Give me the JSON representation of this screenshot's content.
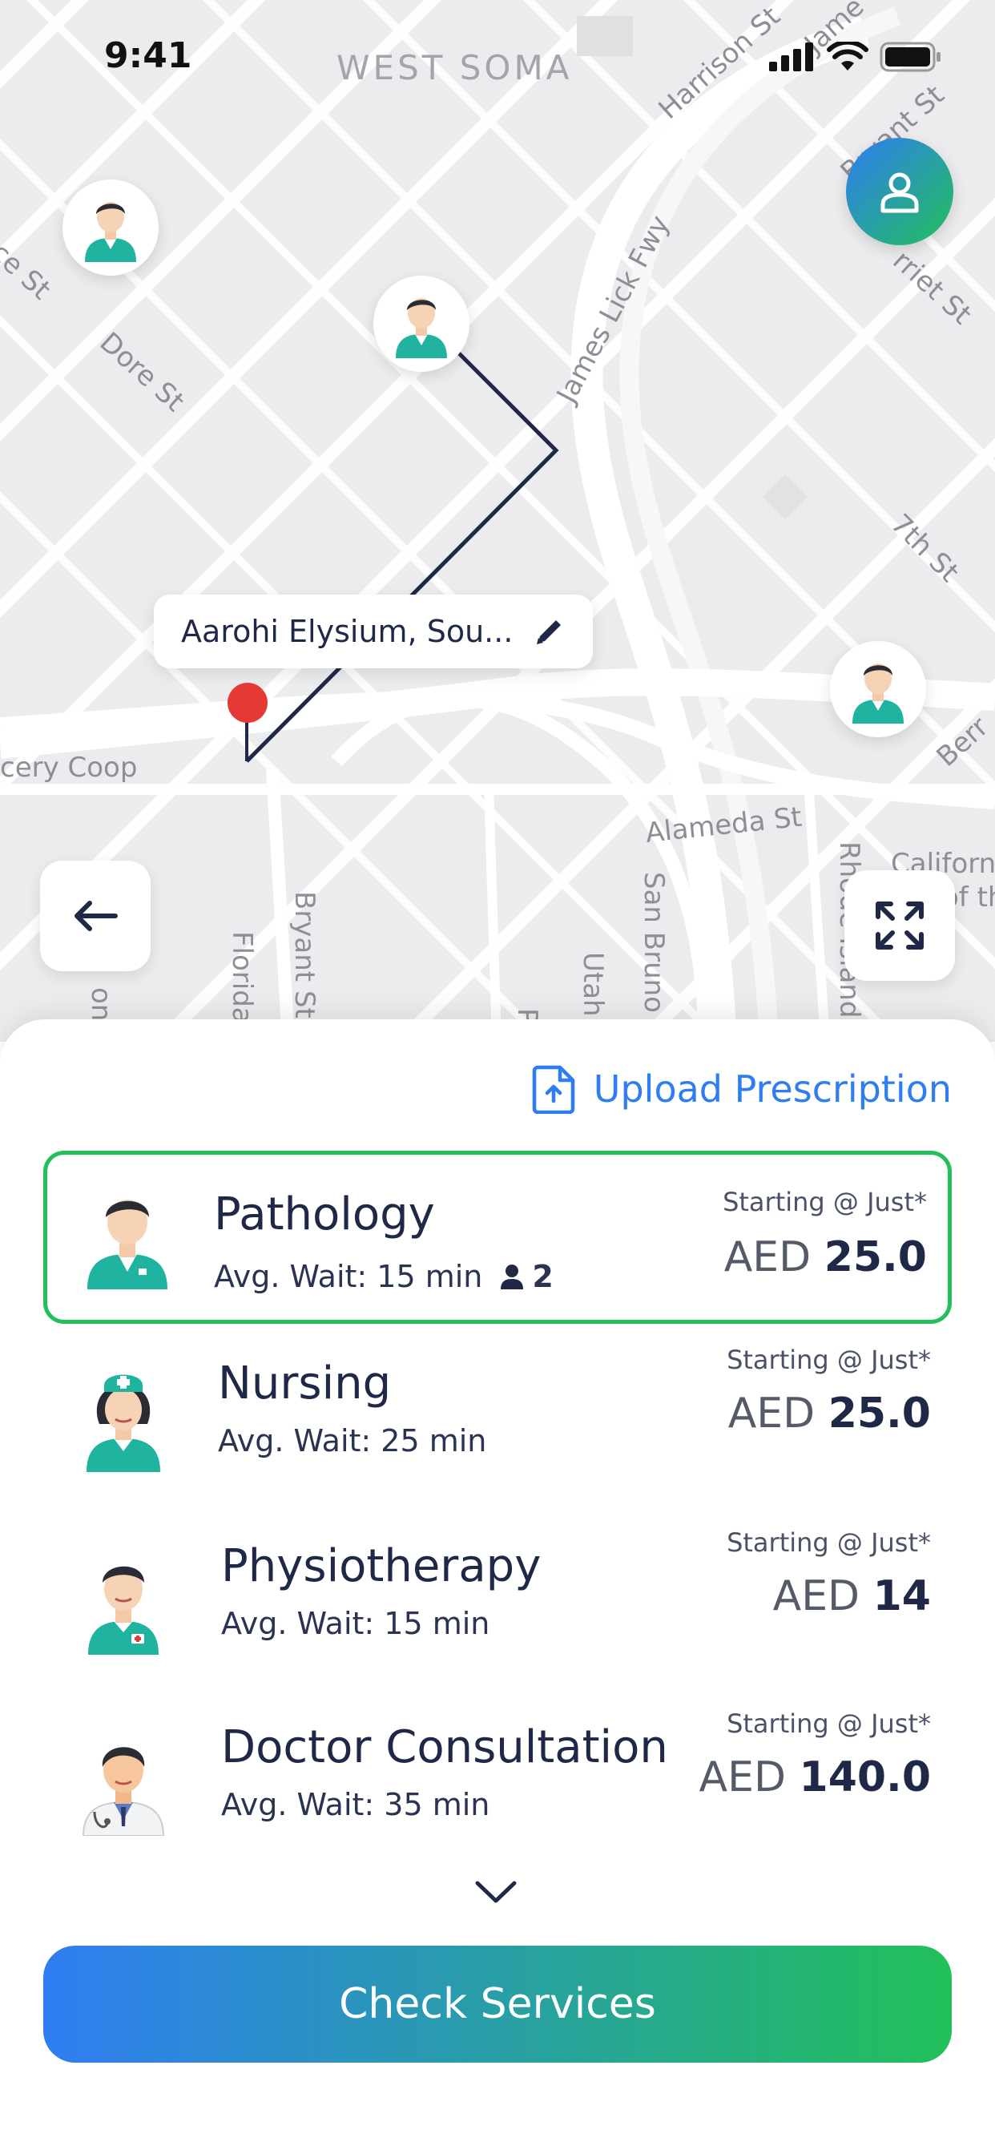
{
  "status_bar": {
    "time": "9:41"
  },
  "map": {
    "labels": {
      "west_soma": "WEST SOMA",
      "harrison_st": "Harrison St",
      "jame": "Jame",
      "bryant_st_top": "Bryant St",
      "harriet_st": "rriet St",
      "ce_st": "ce St",
      "dore_st": "Dore St",
      "james_lick_fwy": "James Lick Fwy",
      "seventh_st": "7th St",
      "berry": "Berr",
      "grocery_coop": "cery Coop",
      "alameda_st": "Alameda St",
      "california": "Californ",
      "of_th": "of th",
      "rhode_island": "Rhode Island S",
      "florida": "Florida S",
      "bryant_st_bottom": "Bryant St",
      "utah": "Utah S",
      "san_bruno": "San Bruno A",
      "po": "Po",
      "on_s": "on S"
    },
    "address_chip": {
      "text": "Aarohi Elysium, Sou..."
    },
    "icons": {
      "back": "arrow-left-icon",
      "expand": "expand-icon",
      "profile": "user-icon",
      "edit": "pencil-icon",
      "location_pin": "location-pin-icon"
    }
  },
  "sheet": {
    "upload_label": "Upload Prescription",
    "services": [
      {
        "name": "Pathology",
        "wait": "Avg. Wait: 15 min",
        "queue": "2",
        "starting": "Starting @ Just*",
        "currency": "AED",
        "amount": "25.0",
        "selected": true,
        "avatar": "male-lab-tech-avatar"
      },
      {
        "name": "Nursing",
        "wait": "Avg. Wait: 25 min",
        "queue": "",
        "starting": "Starting @ Just*",
        "currency": "AED",
        "amount": "25.0",
        "selected": false,
        "avatar": "nurse-avatar"
      },
      {
        "name": "Physiotherapy",
        "wait": "Avg. Wait: 15 min",
        "queue": "",
        "starting": "Starting @ Just*",
        "currency": "AED",
        "amount": "14",
        "selected": false,
        "avatar": "physiotherapist-avatar"
      },
      {
        "name": "Doctor Consultation",
        "wait": "Avg. Wait: 35 min",
        "queue": "",
        "starting": "Starting @ Just*",
        "currency": "AED",
        "amount": "140.0",
        "selected": false,
        "avatar": "doctor-avatar"
      }
    ],
    "cta_label": "Check Services"
  },
  "colors": {
    "accent_blue": "#2f7df2",
    "accent_green": "#22c05a",
    "navy": "#1f2847",
    "route": "#1f2847",
    "pin_red": "#e53935"
  }
}
